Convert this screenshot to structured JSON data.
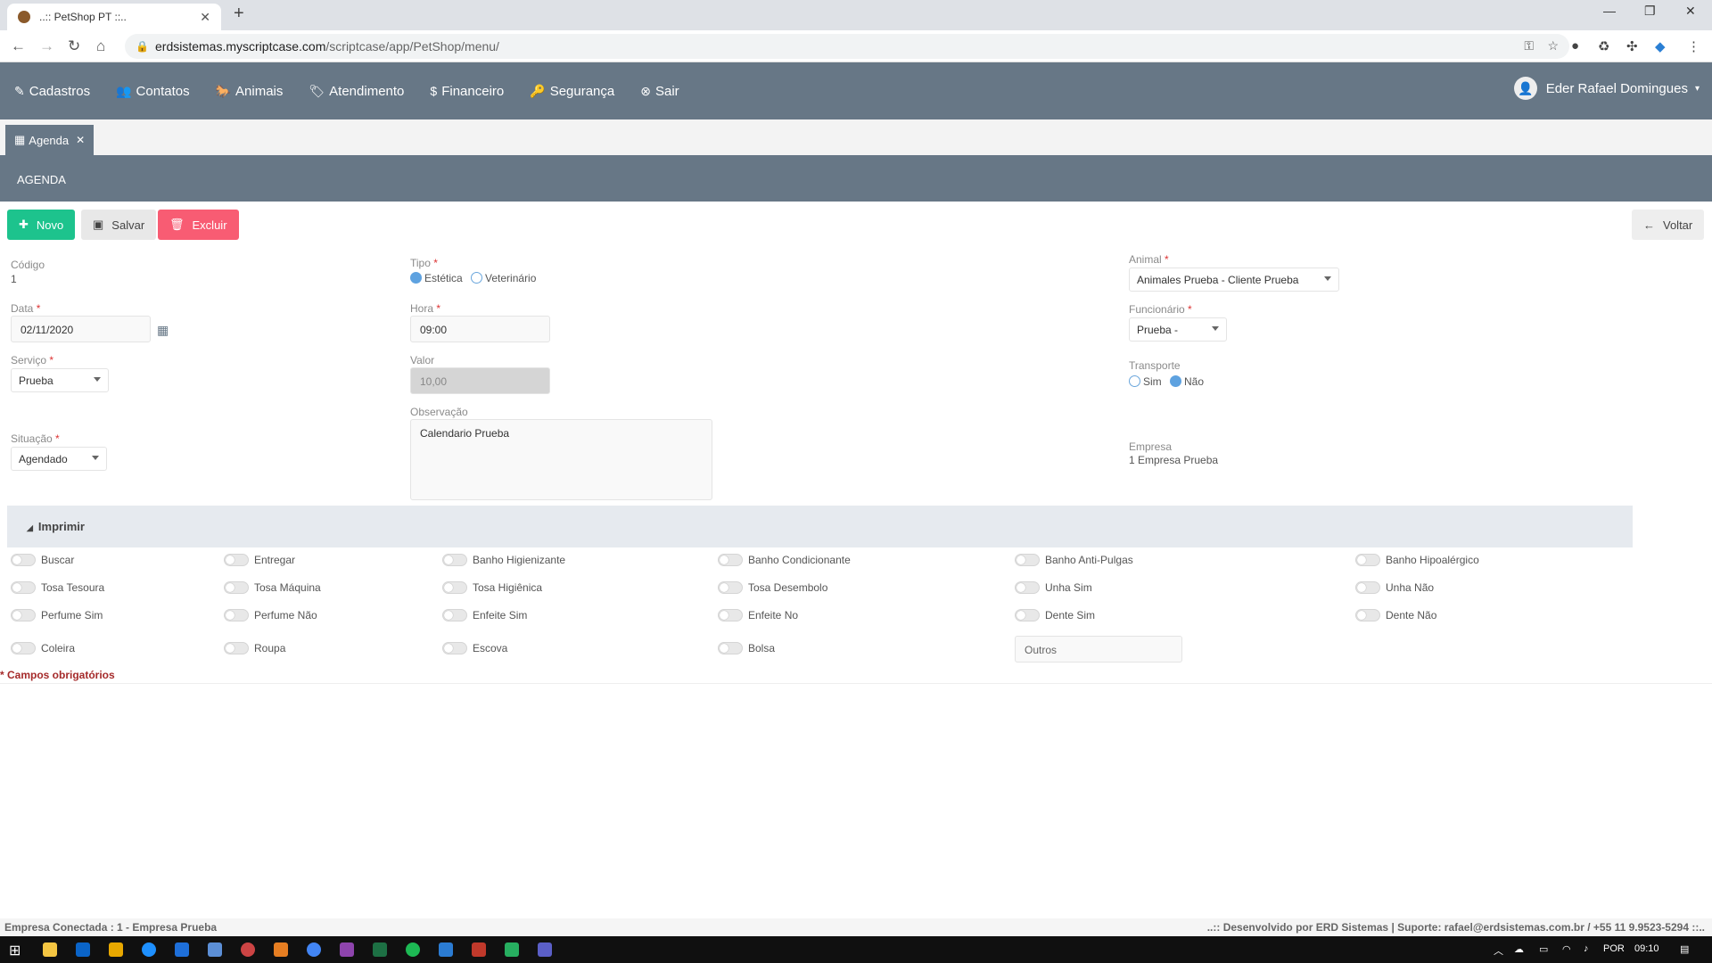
{
  "browser": {
    "tab_title": "..:: PetShop PT ::..",
    "url_host": "erdsistemas.myscriptcase.com",
    "url_path": "/scriptcase/app/PetShop/menu/"
  },
  "nav": {
    "items": [
      "Cadastros",
      "Contatos",
      "Animais",
      "Atendimento",
      "Financeiro",
      "Segurança",
      "Sair"
    ],
    "user": "Eder Rafael Domingues"
  },
  "tab": {
    "label": "Agenda"
  },
  "header": {
    "title": "AGENDA"
  },
  "toolbar": {
    "novo": "Novo",
    "salvar": "Salvar",
    "excluir": "Excluir",
    "voltar": "Voltar"
  },
  "form": {
    "codigo_label": "Código",
    "codigo_value": "1",
    "data_label": "Data",
    "data_value": "02/11/2020",
    "servico_label": "Serviço",
    "servico_value": "Prueba",
    "situacao_label": "Situação",
    "situacao_value": "Agendado",
    "tipo_label": "Tipo",
    "tipo_opt1": "Estética",
    "tipo_opt2": "Veterinário",
    "hora_label": "Hora",
    "hora_value": "09:00",
    "valor_label": "Valor",
    "valor_value": "10,00",
    "obs_label": "Observação",
    "obs_value": "Calendario Prueba",
    "animal_label": "Animal",
    "animal_value": "Animales Prueba - Cliente Prueba",
    "func_label": "Funcionário",
    "func_value": "Prueba -",
    "transporte_label": "Transporte",
    "transp_opt1": "Sim",
    "transp_opt2": "Não",
    "empresa_label": "Empresa",
    "empresa_value": "1 Empresa Prueba"
  },
  "print": {
    "title": "Imprimir",
    "row1": [
      "Buscar",
      "Entregar",
      "Banho Higienizante",
      "Banho Condicionante",
      "Banho Anti-Pulgas",
      "Banho Hipoalérgico"
    ],
    "row2": [
      "Tosa Tesoura",
      "Tosa Máquina",
      "Tosa Higiênica",
      "Tosa Desembolo",
      "Unha Sim",
      "Unha Não"
    ],
    "row3": [
      "Perfume Sim",
      "Perfume Não",
      "Enfeite Sim",
      "Enfeite No",
      "Dente Sim",
      "Dente Não"
    ],
    "row4": [
      "Coleira",
      "Roupa",
      "Escova",
      "Bolsa"
    ],
    "outros_placeholder": "Outros"
  },
  "required_note": "* Campos obrigatórios",
  "footer": {
    "left": "Empresa Conectada : 1 - Empresa Prueba",
    "right": "..:: Desenvolvido por ERD Sistemas | Suporte: rafael@erdsistemas.com.br / +55 11 9.9523-5294 ::.."
  },
  "taskbar": {
    "lang": "POR",
    "time": "09:10"
  }
}
